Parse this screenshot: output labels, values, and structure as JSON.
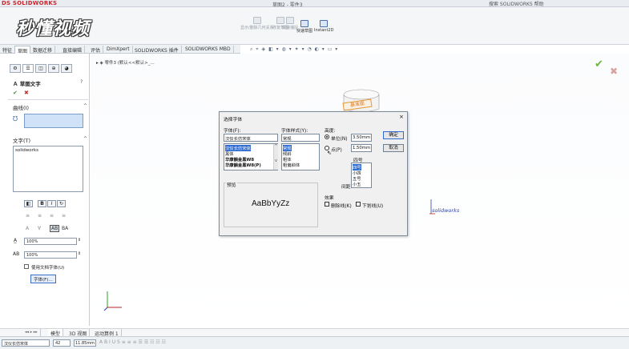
{
  "app": {
    "logo": "DS SOLIDWORKS",
    "doc_title": "草图2 - 零件3",
    "search_placeholder": "搜索 SOLIDWORKS 帮助",
    "watermark": "秒懂视频"
  },
  "ribbon": {
    "buttons": [
      {
        "label": "显示/删除几何关系",
        "active": false
      },
      {
        "label": "修复草图",
        "active": false
      },
      {
        "label": "快速捕捉",
        "active": false
      },
      {
        "label": "快速草图",
        "active": true
      },
      {
        "label": "Instant2D",
        "active": true
      }
    ]
  },
  "tabs": [
    "特征",
    "草图",
    "数据迁移",
    "直接编辑",
    "评估",
    "DimXpert",
    "SOLIDWORKS 插件",
    "SOLIDWORKS MBD"
  ],
  "tree_crumb": "零件3 (默认<<默认>_...",
  "left_panel": {
    "title": "草图文字",
    "curves_header": "曲线(I)",
    "text_header": "文字(T)",
    "text_value": "solidworks",
    "width_value": "100%",
    "spacing_value": "100%",
    "use_doc_font": "使用文档字体(U)",
    "font_button": "字体(F)..."
  },
  "dialog": {
    "title": "选择字体",
    "font_label": "字体(F):",
    "font_value": "汉仪长仿宋体",
    "font_list": [
      "汉仪长仿宋体",
      "黑体",
      "华康韻金黑W8",
      "华康韻金黑W8(P)"
    ],
    "style_label": "字体样式(Y):",
    "style_value": "常规",
    "style_list": [
      "常规",
      "倾斜",
      "粗体",
      "粗偏斜体"
    ],
    "height_label": "高度:",
    "units_label": "单位(N)",
    "units_value": "3.50mm",
    "points_label": "点(P)",
    "points_value": "1.50mm",
    "size_label": "四号",
    "size_list": [
      "四号",
      "小四",
      "五号",
      "小五"
    ],
    "spacing_label": "间距",
    "preview_label": "预览",
    "preview_text": "AaBbYyZz",
    "effects_label": "效果",
    "strike_label": "删除线(K)",
    "underline_label": "下划线(U)",
    "ok": "确定",
    "cancel": "取消",
    "close": "×"
  },
  "viewport": {
    "label_on_cylinder": "基准面",
    "sketch_text": "solidworks"
  },
  "bottom_tabs": [
    "模型",
    "3D 视图",
    "运动算例 1"
  ],
  "status": {
    "font": "汉仪长仿宋体",
    "size": "42",
    "height": "11.85mm"
  }
}
